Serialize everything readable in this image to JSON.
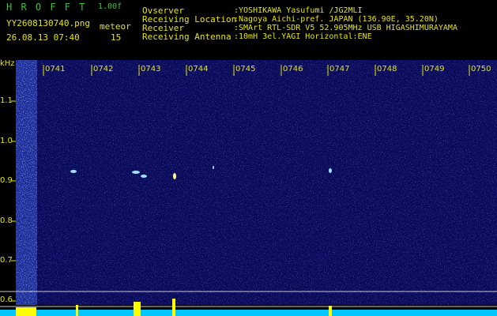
{
  "header": {
    "app_name": "H R O F F T",
    "version": "1.00f",
    "filename": "YY2608130740.png",
    "datetime": "26.08.13 07:40",
    "meteor_label": "meteor",
    "meteor_count": "15",
    "info_labels": [
      "Ovserver",
      "Receiving Location",
      "Receiver",
      "Receiving Antenna"
    ],
    "info_values": [
      ":YOSHIKAWA Yasufumi /JG2MLI",
      ":Nagoya Aichi-pref. JAPAN (136.90E, 35.20N)",
      ":SMArt RTL-SDR V5 52.905MHz USB HIGASHIMURAYAMA",
      ":10mH 3el.YAGI Horizontal:ENE"
    ]
  },
  "axis": {
    "y_unit": "kHz",
    "y_ticks": [
      "1.1",
      "1.0",
      "0.9",
      "0.8",
      "0.7",
      "0.6"
    ],
    "x_ticks": [
      "0741",
      "0742",
      "0743",
      "0744",
      "0745",
      "0746",
      "0747",
      "0748",
      "0749",
      "0750"
    ]
  },
  "colors": {
    "background": "#000000",
    "spectrogram": "#0a0a5a",
    "noise_light": "#3f5fff",
    "meteor_echo": "#9fdfff",
    "signal_baseline": "#00c8ff",
    "peak": "#ffff00",
    "label": "#e6e600"
  }
}
